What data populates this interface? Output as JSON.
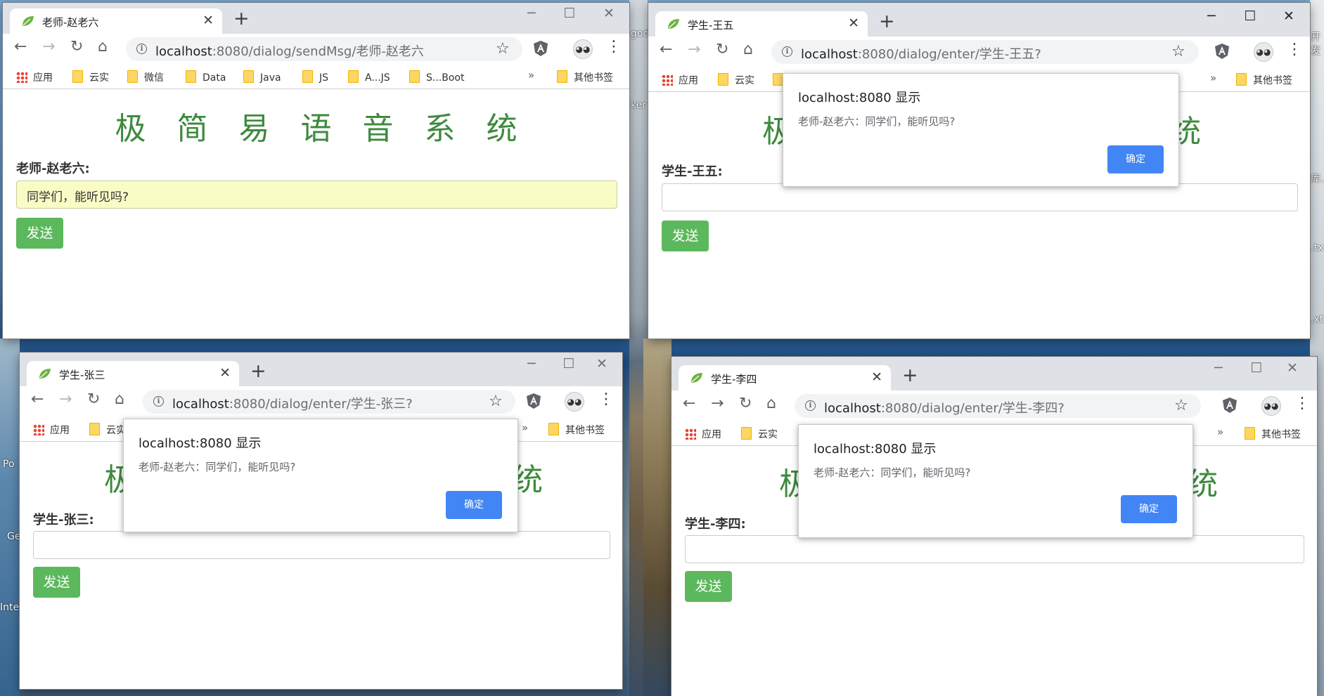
{
  "desktop": {
    "edge_labels": {
      "godl": "god",
      "ker": "ker",
      "po": "Po",
      "ge": "Ge",
      "inte": "Inte",
      "kai": "开发",
      "ku": "库.",
      "tx1": ".tx",
      "tx2": ".xt"
    }
  },
  "bookmark_labels": {
    "apps": "应用",
    "yunshi": "云实",
    "weixin": "微信",
    "data": "Data",
    "java": "Java",
    "js": "JS",
    "ajs": "A...JS",
    "sboot": "S...Boot",
    "more": "»",
    "other": "其他书签"
  },
  "page": {
    "heading": "极　简　易　语　音　系　统",
    "heading_left_char": "极",
    "heading_right_char": "统",
    "send_label": "发送"
  },
  "alert": {
    "title": "localhost:8080 显示",
    "message": "老师-赵老六：同学们，能听见吗?",
    "ok_label": "确定"
  },
  "windows": {
    "teacher": {
      "tab_title": "老师-赵老六",
      "url_host": "localhost",
      "url_path": ":8080/dialog/sendMsg/老师-赵老六",
      "user_label": "老师-赵老六:",
      "input_value": "同学们，能听见吗?"
    },
    "wangwu": {
      "tab_title": "学生-王五",
      "url_host": "localhost",
      "url_path": ":8080/dialog/enter/学生-王五?",
      "user_label": "学生-王五:",
      "input_value": ""
    },
    "zhangsan": {
      "tab_title": "学生-张三",
      "url_host": "localhost",
      "url_path": ":8080/dialog/enter/学生-张三?",
      "user_label": "学生-张三:",
      "input_value": ""
    },
    "lisi": {
      "tab_title": "学生-李四",
      "url_host": "localhost",
      "url_path": ":8080/dialog/enter/学生-李四?",
      "user_label": "学生-李四:",
      "input_value": ""
    }
  },
  "icons": {
    "back": "←",
    "forward": "→",
    "reload": "↻",
    "home": "⌂",
    "star": "☆",
    "menu": "⋮",
    "close": "✕",
    "new_tab": "+",
    "minimize": "─",
    "maximize": "☐",
    "info": "i",
    "avatar": "◕◕"
  },
  "colors": {
    "accent_green": "#5cb85c",
    "heading_green": "#3e8a3e",
    "alert_blue": "#4285f4",
    "filled_input": "#fafcc6"
  }
}
